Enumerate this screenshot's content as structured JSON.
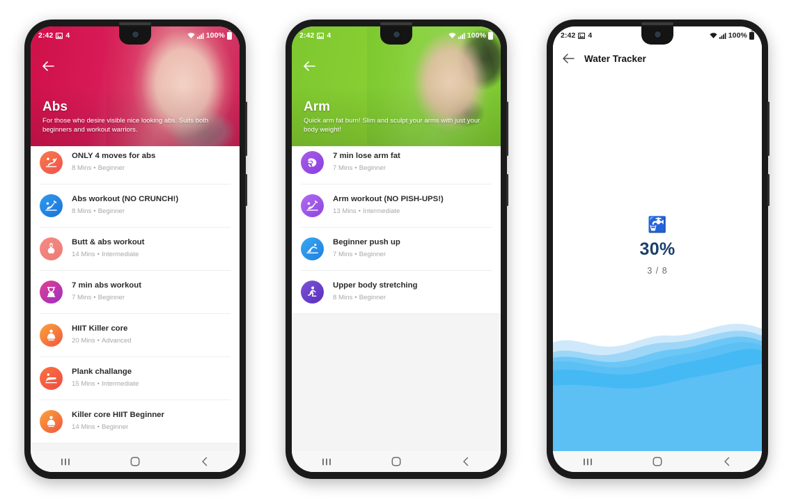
{
  "statusbar": {
    "time": "2:42",
    "image_icon": "image-icon",
    "notification_count": "4",
    "wifi_icon": "wifi-icon",
    "signal_icon": "signal-icon",
    "battery_text": "100%",
    "battery_icon": "battery-full-icon"
  },
  "navbar": {
    "recents_label": "|||",
    "home_label": "home",
    "back_label": "back"
  },
  "phones": [
    {
      "name": "abs-workout-screen",
      "hero": {
        "title": "Abs",
        "subtitle": "For those who desire visible nice looking abs. Suits both beginners and workout warriors.",
        "back_icon": "back-arrow-icon",
        "accent": "#cf1049"
      },
      "workouts": [
        {
          "title": "ONLY 4 moves for abs",
          "mins": "8 Mins",
          "level": "Beginner",
          "icon": "situp-icon",
          "c1": "#f77b49",
          "c2": "#f2504f"
        },
        {
          "title": "Abs workout (NO CRUNCH!)",
          "mins": "8 Mins",
          "level": "Beginner",
          "icon": "leg-raise-icon",
          "c1": "#2e9bf0",
          "c2": "#1b72d8"
        },
        {
          "title": "Butt & abs workout",
          "mins": "14 Mins",
          "level": "Intermediate",
          "icon": "glutes-icon",
          "c1": "#f48a86",
          "c2": "#ef7b74"
        },
        {
          "title": "7 min abs workout",
          "mins": "7 Mins",
          "level": "Beginner",
          "icon": "timer-abs-icon",
          "c1": "#e33f8f",
          "c2": "#9b2fc4"
        },
        {
          "title": "HIIT Killer core",
          "mins": "20 Mins",
          "level": "Advanced",
          "icon": "core-hiit-icon",
          "c1": "#fba43a",
          "c2": "#f0563f"
        },
        {
          "title": "Plank challange",
          "mins": "15 Mins",
          "level": "Intermediate",
          "icon": "plank-icon",
          "c1": "#f9743f",
          "c2": "#ef4a42"
        },
        {
          "title": "Killer core HIIT Beginner",
          "mins": "14 Mins",
          "level": "Beginner",
          "icon": "core-hiit-icon",
          "c1": "#fba43a",
          "c2": "#f0563f"
        }
      ]
    },
    {
      "name": "arm-workout-screen",
      "hero": {
        "title": "Arm",
        "subtitle": "Quick arm fat burn! Slim and sculpt your arms with just your body weight!",
        "back_icon": "back-arrow-icon",
        "accent": "#7ec72f"
      },
      "workouts": [
        {
          "title": "7 min lose arm fat",
          "mins": "7 Mins",
          "level": "Beginner",
          "icon": "biceps-icon",
          "c1": "#a85de8",
          "c2": "#8b3ede"
        },
        {
          "title": "Arm workout (NO PISH-UPS!)",
          "mins": "13 Mins",
          "level": "Intermediate",
          "icon": "leg-raise-icon",
          "c1": "#b06cf0",
          "c2": "#8d45e2"
        },
        {
          "title": "Beginner push up",
          "mins": "7 Mins",
          "level": "Beginner",
          "icon": "pushup-icon",
          "c1": "#3aa8f2",
          "c2": "#1f7fe0"
        },
        {
          "title": "Upper body stretching",
          "mins": "8 Mins",
          "level": "Beginner",
          "icon": "stretch-icon",
          "c1": "#7b52d6",
          "c2": "#5b2fbe"
        }
      ]
    },
    {
      "name": "water-tracker-screen",
      "appbar": {
        "back_icon": "back-arrow-icon",
        "title": "Water Tracker"
      },
      "tracker": {
        "faucet_icon": "faucet-icon",
        "percent": "30%",
        "fraction": "3 / 8",
        "percent_color": "#1b3f6b",
        "water_colors": [
          "#cfe9fb",
          "#9ed6f7",
          "#5cc0f5",
          "#3bb5f2",
          "#6cc7f7"
        ]
      }
    }
  ]
}
